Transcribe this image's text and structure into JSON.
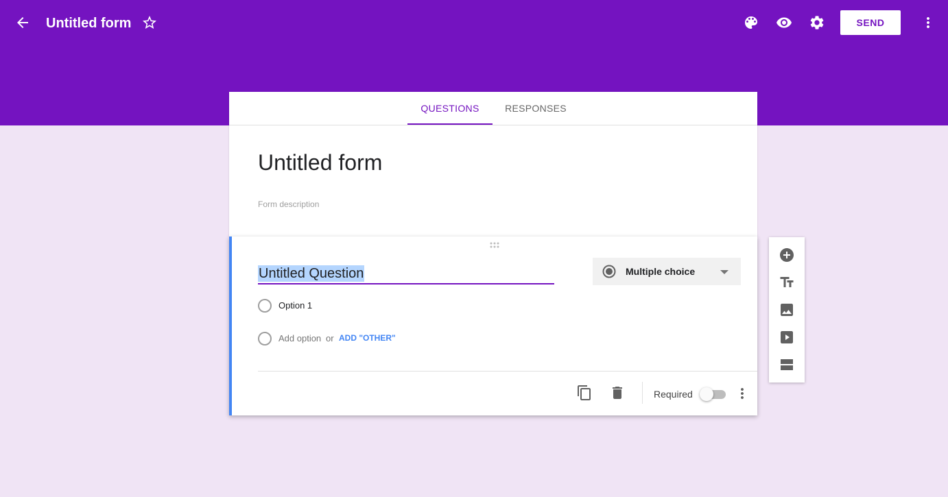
{
  "header": {
    "title": "Untitled form",
    "send_label": "SEND",
    "icons": [
      "back-arrow-icon",
      "star-icon",
      "palette-icon",
      "eye-icon",
      "gear-icon",
      "more-vert-icon"
    ]
  },
  "tabs": [
    {
      "label": "QUESTIONS",
      "active": true
    },
    {
      "label": "RESPONSES",
      "active": false
    }
  ],
  "form": {
    "title": "Untitled form",
    "description_placeholder": "Form description"
  },
  "question": {
    "title": "Untitled Question",
    "type_label": "Multiple choice",
    "options": [
      {
        "label": "Option 1"
      }
    ],
    "add_option_label": "Add option",
    "or_label": "or",
    "add_other_label": "ADD \"OTHER\"",
    "required_label": "Required",
    "required": false
  },
  "side_toolbar": {
    "icons": [
      "add-circle-icon",
      "title-text-icon",
      "image-icon",
      "video-icon",
      "section-icon"
    ]
  },
  "colors": {
    "accent": "#7413c0",
    "background": "#f0e4f5",
    "focus_border": "#4285f4"
  }
}
